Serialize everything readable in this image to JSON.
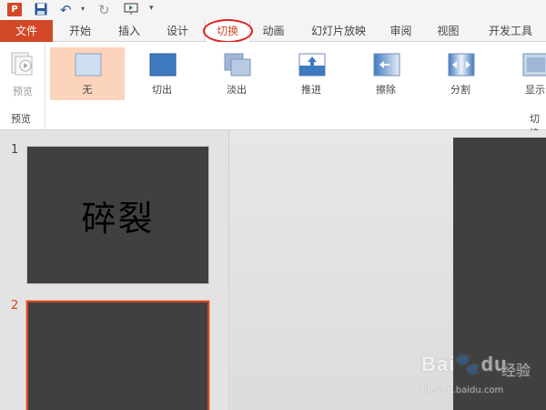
{
  "quick_access": {
    "app_icon": "powerpoint-logo",
    "app_icon_letter": "P",
    "items": [
      "save-icon",
      "undo-icon",
      "redo-icon",
      "start-slideshow-icon",
      "customize-arrow-icon"
    ]
  },
  "tabs": {
    "file": "文件",
    "home": "开始",
    "insert": "插入",
    "design": "设计",
    "transitions": "切换",
    "animations": "动画",
    "slideshow": "幻灯片放映",
    "review": "审阅",
    "view": "视图",
    "developer": "开发工具"
  },
  "ribbon": {
    "preview_label": "预览",
    "preview_group": "预览",
    "transition_group_partial": "切换",
    "transitions": [
      {
        "label": "无",
        "icon": "none-transition-icon",
        "selected": true
      },
      {
        "label": "切出",
        "icon": "cut-transition-icon",
        "selected": false
      },
      {
        "label": "淡出",
        "icon": "fade-transition-icon",
        "selected": false
      },
      {
        "label": "推进",
        "icon": "push-transition-icon",
        "selected": false
      },
      {
        "label": "擦除",
        "icon": "wipe-transition-icon",
        "selected": false
      },
      {
        "label": "分割",
        "icon": "split-transition-icon",
        "selected": false
      },
      {
        "label": "显示",
        "icon": "reveal-transition-icon",
        "selected": false
      }
    ]
  },
  "slides": [
    {
      "number": "1",
      "title": "碎裂",
      "active": false
    },
    {
      "number": "2",
      "title": "",
      "active": true
    }
  ],
  "watermark": {
    "brand": "Bai",
    "brand2": "du",
    "jingyan": "经验",
    "url": "jingyan.baidu.com"
  },
  "colors": {
    "accent": "#d24726",
    "selected_transition_bg": "#fcd3bb",
    "slide_bg": "#404040",
    "highlight_ring": "#e0201f"
  }
}
